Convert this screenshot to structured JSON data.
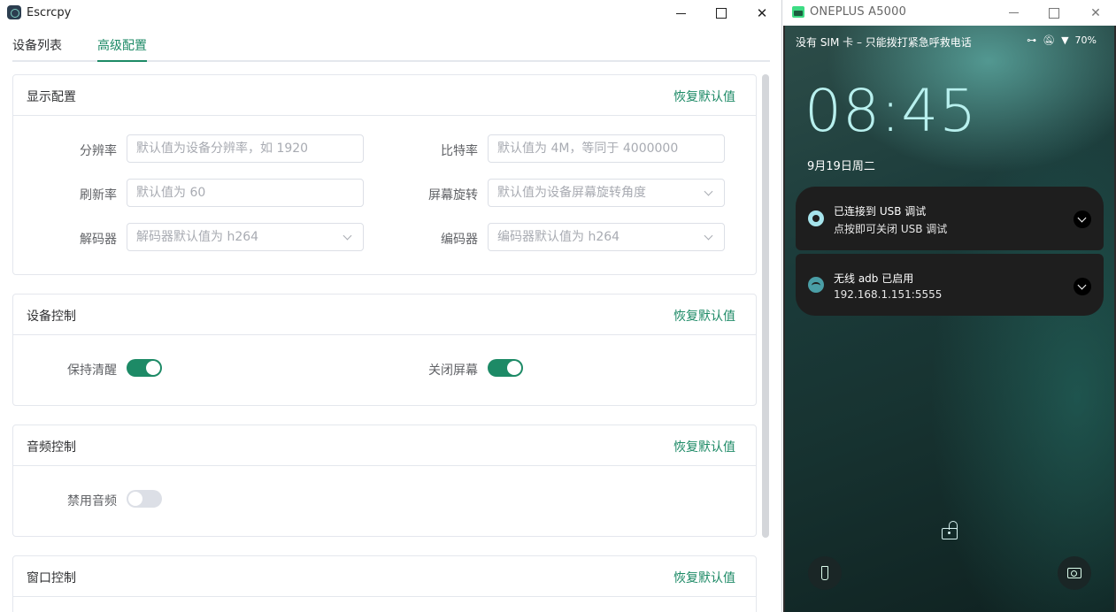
{
  "app": {
    "title": "Escrcpy",
    "tabs": [
      {
        "label": "设备列表",
        "active": false
      },
      {
        "label": "高级配置",
        "active": true
      }
    ],
    "accent_color": "#1d8a66"
  },
  "sections": {
    "display": {
      "title": "显示配置",
      "reset_label": "恢复默认值",
      "fields": {
        "resolution": {
          "label": "分辨率",
          "placeholder": "默认值为设备分辨率，如 1920"
        },
        "bitrate": {
          "label": "比特率",
          "placeholder": "默认值为 4M，等同于 4000000"
        },
        "refresh_rate": {
          "label": "刷新率",
          "placeholder": "默认值为 60"
        },
        "rotation": {
          "label": "屏幕旋转",
          "placeholder": "默认值为设备屏幕旋转角度"
        },
        "decoder": {
          "label": "解码器",
          "placeholder": "解码器默认值为 h264"
        },
        "encoder": {
          "label": "编码器",
          "placeholder": "编码器默认值为 h264"
        }
      }
    },
    "device_control": {
      "title": "设备控制",
      "reset_label": "恢复默认值",
      "stay_awake": {
        "label": "保持清醒",
        "on": true
      },
      "turn_screen_off": {
        "label": "关闭屏幕",
        "on": true
      }
    },
    "audio_control": {
      "title": "音频控制",
      "reset_label": "恢复默认值",
      "disable_audio": {
        "label": "禁用音频",
        "on": false
      }
    },
    "window_control": {
      "title": "窗口控制",
      "reset_label": "恢复默认值"
    }
  },
  "phone": {
    "window_title": "ONEPLUS A5000",
    "status_bar": {
      "carrier_text": "没有 SIM 卡 – 只能拨打紧急呼救电话",
      "battery": "70%",
      "icons": [
        "link-icon",
        "mute-icon",
        "wifi-icon"
      ]
    },
    "clock": "08:45",
    "date": "9月19日周二",
    "notifications": [
      {
        "title": "已连接到 USB 调试",
        "subtitle": "点按即可关闭 USB 调试",
        "icon": "usb-debug-icon"
      },
      {
        "title": "无线 adb 已启用",
        "subtitle": "192.168.1.151:5555",
        "icon": "wireless-adb-icon"
      }
    ]
  }
}
